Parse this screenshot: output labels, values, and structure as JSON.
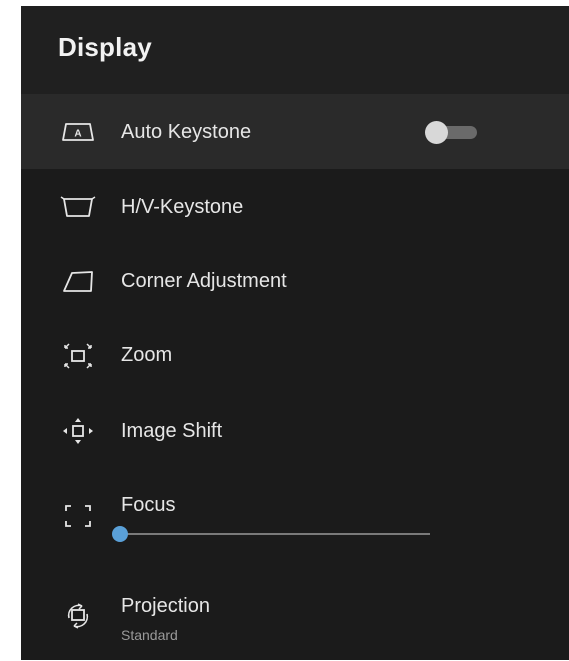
{
  "header": {
    "title": "Display"
  },
  "menu": {
    "items": [
      {
        "label": "Auto Keystone",
        "icon": "auto-keystone-icon",
        "selected": true,
        "toggle_on": false
      },
      {
        "label": "H/V-Keystone",
        "icon": "hv-keystone-icon"
      },
      {
        "label": "Corner Adjustment",
        "icon": "corner-adjustment-icon"
      },
      {
        "label": "Zoom",
        "icon": "zoom-icon"
      },
      {
        "label": "Image Shift",
        "icon": "image-shift-icon"
      },
      {
        "label": "Focus",
        "icon": "focus-icon",
        "slider_value": 0.0
      },
      {
        "label": "Projection",
        "icon": "projection-icon",
        "value": "Standard"
      }
    ]
  },
  "colors": {
    "panel_background": "#1b1b1b",
    "header_background": "#202020",
    "selected_row": "#2a2a2a",
    "slider_accent": "#5aa0d8"
  }
}
